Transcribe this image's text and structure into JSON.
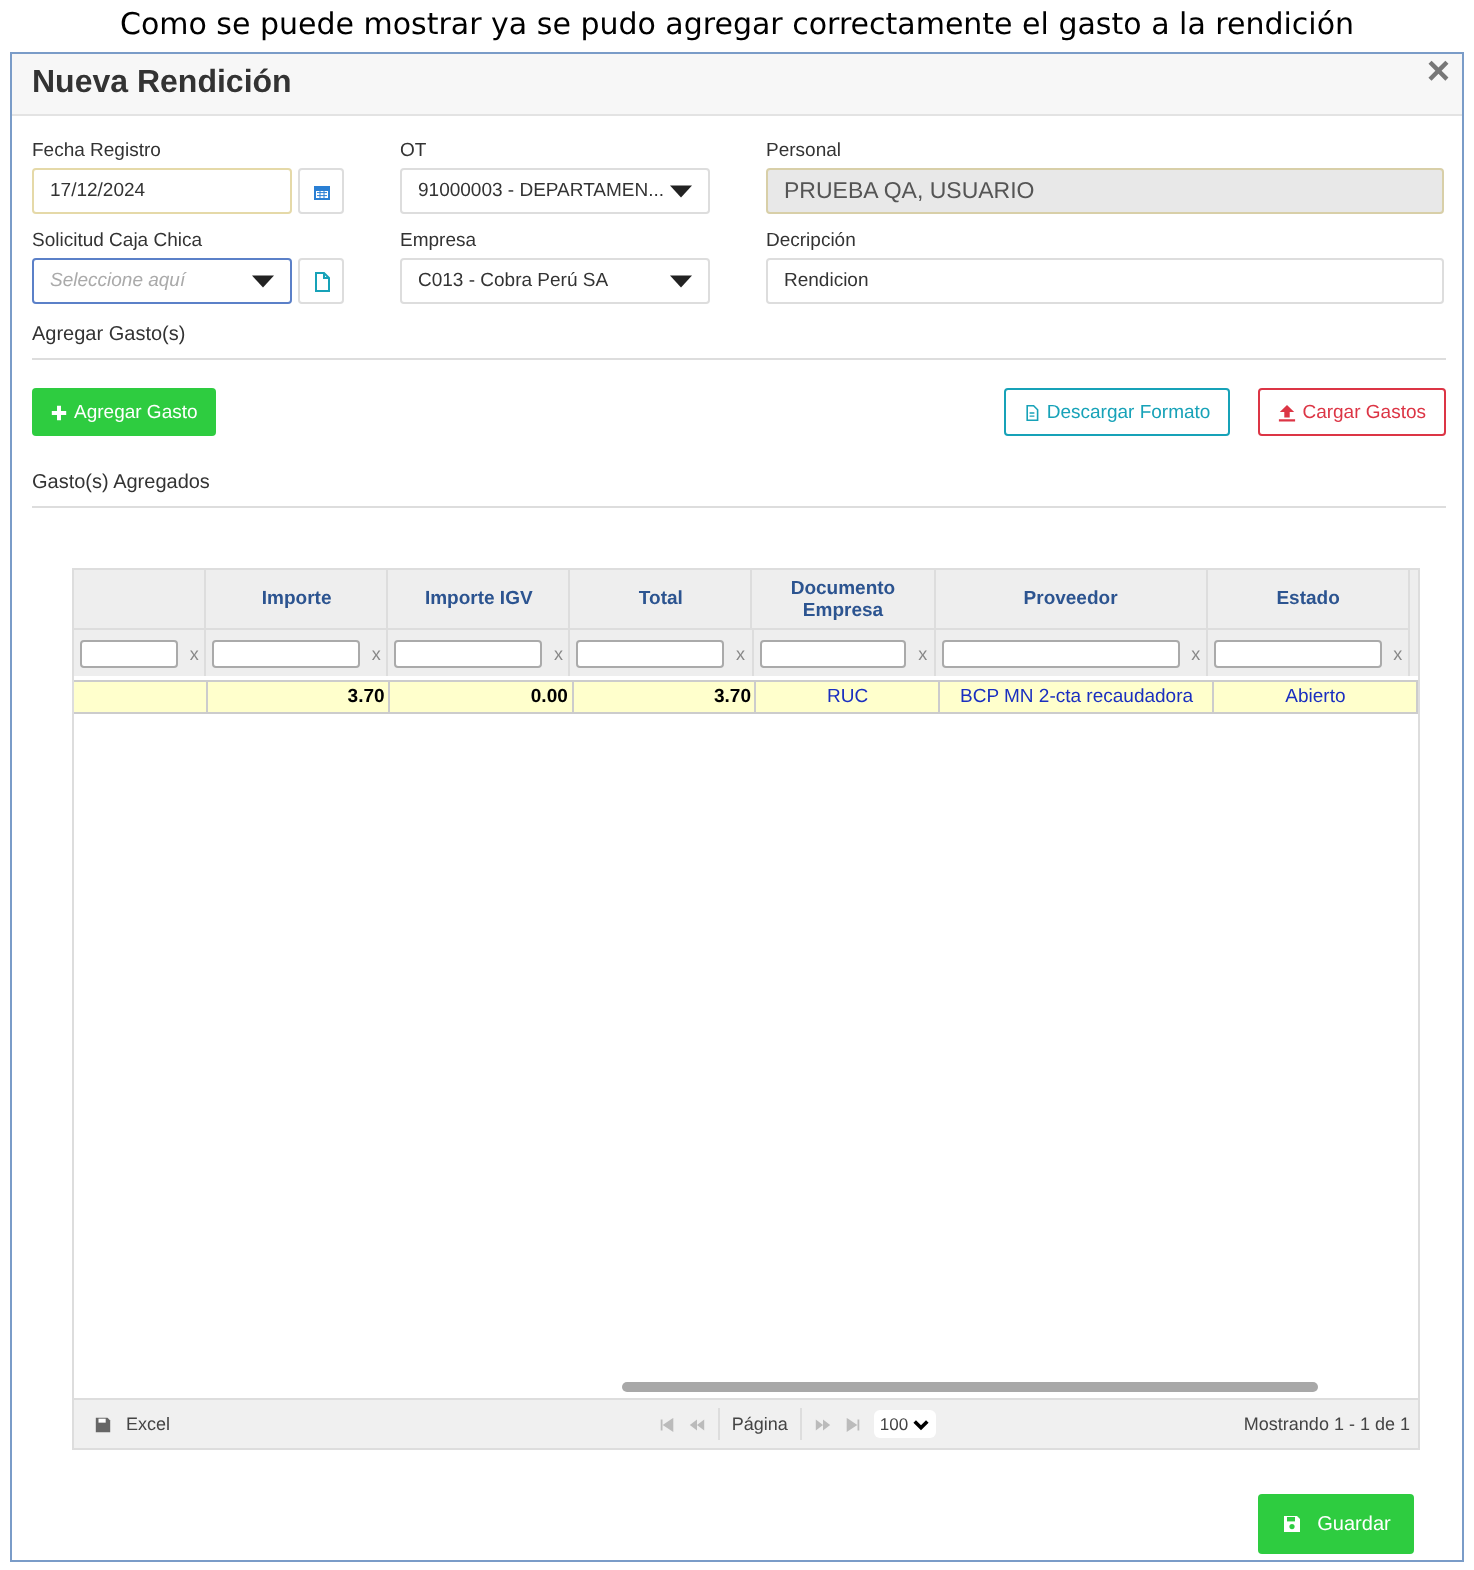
{
  "caption": "Como se puede mostrar ya se pudo agregar correctamente el gasto a la rendición",
  "dialog": {
    "title": "Nueva Rendición",
    "close": "×"
  },
  "fields": [
    {
      "label": "Fecha Registro",
      "kind": "date",
      "value": "17/12/2024"
    },
    {
      "label": "OT",
      "kind": "select",
      "value": "91000003 - DEPARTAMEN..."
    },
    {
      "label": "Personal",
      "kind": "readonly",
      "value": "PRUEBA QA, USUARIO"
    },
    {
      "label": "Solicitud Caja Chica",
      "kind": "select-doc",
      "placeholder": "Seleccione aquí"
    },
    {
      "label": "Empresa",
      "kind": "select",
      "value": "C013 - Cobra Perú SA"
    },
    {
      "label": "Decripción",
      "kind": "text",
      "value": "Rendicion"
    }
  ],
  "add_section": {
    "title": "Agregar Gasto(s)",
    "add_button": "Agregar Gasto",
    "download_button": "Descargar Formato",
    "upload_button": "Cargar Gastos"
  },
  "list_section": {
    "title": "Gasto(s) Agregados"
  },
  "table": {
    "columns": [
      "",
      "Importe",
      "Importe IGV",
      "Total",
      "Documento Empresa",
      "Proveedor",
      "Estado"
    ],
    "filters": [
      {
        "clear": "x"
      },
      {
        "clear": "x"
      },
      {
        "clear": "x"
      },
      {
        "clear": "x"
      },
      {
        "clear": "x"
      },
      {
        "clear": "x"
      },
      {
        "clear": "x"
      }
    ],
    "rows": [
      {
        "selected": true,
        "cells": [
          "",
          "3.70",
          "0.00",
          "3.70",
          "RUC",
          "BCP MN 2-cta recaudadora",
          "Abierto"
        ]
      }
    ]
  },
  "pager": {
    "export": "Excel",
    "page_label": "Página",
    "page_size": "100",
    "summary": "Mostrando 1 - 1 de 1"
  },
  "save_button": "Guardar"
}
